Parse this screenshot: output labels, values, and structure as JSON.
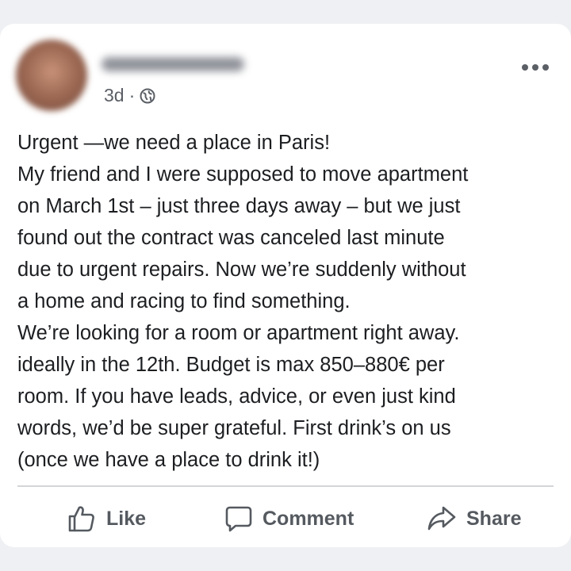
{
  "post": {
    "timestamp": "3d",
    "separator": "·",
    "visibility_icon": "globe-icon",
    "more_icon": "more-horizontal-icon",
    "lines": [
      "Urgent —we need a place in Paris!",
      "My friend and I were supposed to move apartment",
      "on March 1st – just three days away – but we just",
      "found out the contract was canceled last minute",
      "due to urgent repairs. Now we’re suddenly without",
      "a home and racing to find something.",
      "We’re looking for a room or apartment right away.",
      "ideally in the 12th. Budget is max 850–880€ per",
      "room. If you have leads, advice, or even just kind",
      "words, we’d be super grateful. First drink’s on us",
      "(once we have a place to drink it!)"
    ]
  },
  "actions": {
    "like": {
      "label": "Like",
      "icon": "thumbs-up-icon"
    },
    "comment": {
      "label": "Comment",
      "icon": "comment-icon"
    },
    "share": {
      "label": "Share",
      "icon": "share-icon"
    }
  },
  "colors": {
    "text": "#1c1e21",
    "muted": "#5b5f66",
    "action": "#555a60",
    "background": "#eef0f3",
    "card": "#ffffff"
  }
}
